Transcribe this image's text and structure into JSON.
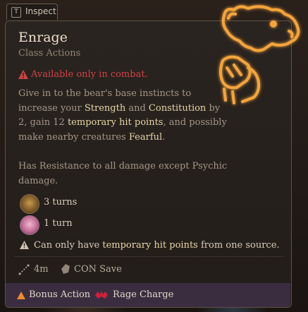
{
  "inspect": {
    "key": "T",
    "label": "Inspect"
  },
  "spell": {
    "title": "Enrage",
    "subtitle": "Class Actions",
    "combat_warning": "Available only in combat.",
    "desc": {
      "p1": "Give in to the bear's base instincts to increase your ",
      "strength": "Strength",
      "and": " and ",
      "constitution": "Constitution",
      "p2": " by 2, gain 12 ",
      "temp_hp": "temporary hit points",
      "p3": ", and possibly make nearby creatures ",
      "fearful": "Fearful",
      "p4": "."
    },
    "resistance": "Has Resistance to all damage except Psychic damage.",
    "durations": [
      {
        "icon": "bear-enrage-icon",
        "text": "3 turns"
      },
      {
        "icon": "fear-icon",
        "text": "1 turn"
      }
    ],
    "note": {
      "pre": "Can only have ",
      "hl": "temporary hit points",
      "post": " from one source."
    },
    "range": "4m",
    "save": "CON Save",
    "costs": {
      "action": "Bonus Action",
      "resource": "Rage Charge"
    }
  },
  "colors": {
    "accent_orange": "#f5a43a",
    "warning_red": "#d14244",
    "highlight": "#e7d6a6",
    "footer_bg": "#3a2d40"
  }
}
